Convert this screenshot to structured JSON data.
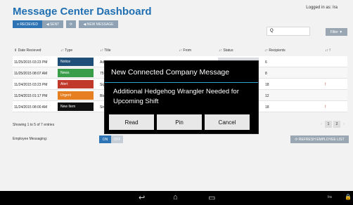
{
  "header": {
    "title": "Message Center Dashboard",
    "logged_in": "Logged in as: Ira"
  },
  "toolbar": {
    "received": "≡ RECIEVED",
    "sent": "◀ SENT",
    "refresh": "⟳",
    "new_message": "◀ NEW MESSAGE"
  },
  "search": {
    "icon": "search-icon",
    "placeholder": "Q"
  },
  "filter": {
    "label": "Filter ▼"
  },
  "table": {
    "headers": [
      "⇕ Date Recieved",
      "↓↑ Type",
      "↓↑ Title",
      "↓↑ From",
      "↓↑ Status",
      "↓↑ Recipients",
      "↓↑ !"
    ],
    "rows": [
      {
        "date": "11/25/2015 03:23 PM",
        "type": "Notice",
        "type_color": "#1f4e79",
        "title": "Add",
        "status_color": "#d9dbe0",
        "recipients": "6",
        "flag": ""
      },
      {
        "date": "11/25/2015 08:07 AM",
        "type": "News",
        "type_color": "#3a9d4a",
        "title": "75°",
        "status_color": "#d9dbe0",
        "recipients": "8",
        "flag": ""
      },
      {
        "date": "11/24/2015 03:23 PM",
        "type": "Alert",
        "type_color": "#c0392b",
        "title": "Sig",
        "status_color": "#d9dbe0",
        "recipients": "18",
        "flag": "!"
      },
      {
        "date": "11/24/2015 01:17 PM",
        "type": "Urgent",
        "type_color": "#e67e22",
        "title": "Ble",
        "status_color": "#d9dbe0",
        "recipients": "12",
        "flag": ""
      },
      {
        "date": "11/24/2015 08:00 AM",
        "type": "New Item",
        "type_color": "#111111",
        "title": "Sir",
        "status_color": "#d9dbe0",
        "recipients": "18",
        "flag": "!"
      }
    ]
  },
  "pagination": {
    "showing": "Showing 1 to 5 of 7 entries",
    "prev": "‹",
    "page1": "1",
    "page2": "2",
    "next": "›"
  },
  "employee_messaging": {
    "label": "Employee Messaging:",
    "on": "ON",
    "off": "OFF"
  },
  "refresh_list": {
    "label": "⟳ REFRESH EMPLOYEE LIST"
  },
  "modal": {
    "title": "New Connected Company Message",
    "body": "Additional Hedgehog Wrangler Needed for Upcoming Shift",
    "buttons": {
      "read": "Read",
      "pin": "Pin",
      "cancel": "Cancel"
    }
  },
  "navbar": {
    "back": "↩",
    "home": "⌂",
    "recents": "▭",
    "user": "Ira",
    "lock": "🔒"
  },
  "colors": {
    "accent": "#1f6fb2",
    "primary_button": "#2e74b5",
    "modal_separator": "#2ba5d6"
  }
}
